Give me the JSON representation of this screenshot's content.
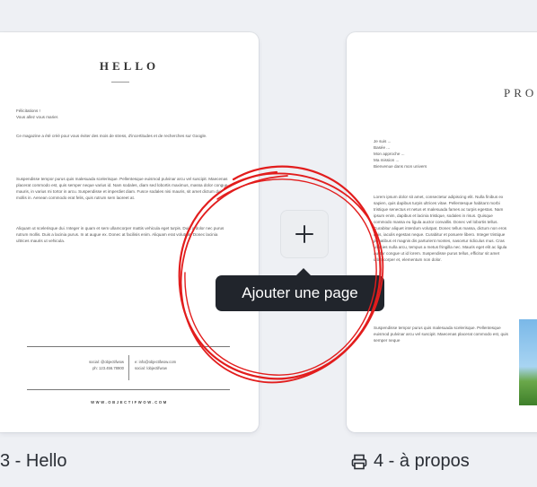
{
  "pages": [
    {
      "label": "3 - Hello",
      "title": "HELLO",
      "greeting": "Félicitations !",
      "greeting_line2": "Vous allez vous marier.",
      "intro": "Ce magazine a été créé pour vous éviter des mois de stress, d'incertitudes et de recherches sur Google.",
      "paragraph1": "Suspendisse tempor purus quis malesuada scelerisque. Pellentesque euismod pulvinar arcu vel suscipit. Maecenas placerat commodo est, quis semper neque varius id. Nam sodales, diam sed lobortis maximus, massa dolor congue mauris, in varius mi tortor in arcu. Suspendisse et imperdiet diam. Fusce sodales nisi mauris, sit amet dictum dui mollis in. Aenean commodo erat felis, quis rutrum sem laoreet at.",
      "paragraph2": "Aliquam ut scelerisque dui. Integer in quam et sem ullamcorper mattis vehicula eget turpis. Duis a dolor nec purus rutrum mollis. Duis a lacinia purus. In at augue ex. Donec at facilisis enim. Aliquam erat volutpat. Donec lacinia ultrices mauris ut vehicula.",
      "footer_left_1": "social: @objectifwow",
      "footer_left_2": "ph: 123.456.78900",
      "footer_right_1": "e: info@objectifwow.com",
      "footer_right_2": "social: /objectifwow",
      "footer_url": "WWW.OBJECTIFWOW.COM"
    },
    {
      "label": "4 - à propos",
      "title": "PRO",
      "lines": [
        "Je suis ...",
        "Basée ...",
        "Mon approche ...",
        "Ma mission ...",
        "Bienvenue dans mon univers"
      ],
      "paragraph1": "Lorem ipsum dolor sit amet, consectetur adipiscing elit. Nulla finibus ex sapien, quis dapibus turpis ultrices vitae. Pellentesque habitant morbi tristique senectus et netus et malesuada fames ac turpis egestas. Nam ipsum enim, dapibus et lacinia tristique, sodales in risus. Quisque commodo massa eu ligula auctor convallis. Donec vel lobortis tellus. Curabitur aliquet interdum volutpat. Donec tellus massa, dictum non eros quis, iaculis egestas neque. Curabitur et posuere libero. Integer tristique penatibus et magnis dis parturient montes, nascetur ridiculus mus. Cras ultricies nulla arcu, tempus a metus fringilla nec. Mauris eget elit ac ligula auctor congue ut id lorem. Suspendisse purus tellus, efficitur sit amet ullamcorper et, elementum non dolor.",
      "paragraph2": "Suspendisse tempor purus quis malesuada scelerisque. Pellentesque euismod pulvinar arcu vel suscipit. Maecenas placerat commodo est, quis semper neque"
    }
  ],
  "add_page": {
    "icon": "plus-icon",
    "tooltip": "Ajouter une page"
  },
  "page_4_icon": "print-icon",
  "colors": {
    "annotation": "#e21d1d",
    "tooltip_bg": "#21252c",
    "canvas_bg": "#eef0f4"
  }
}
